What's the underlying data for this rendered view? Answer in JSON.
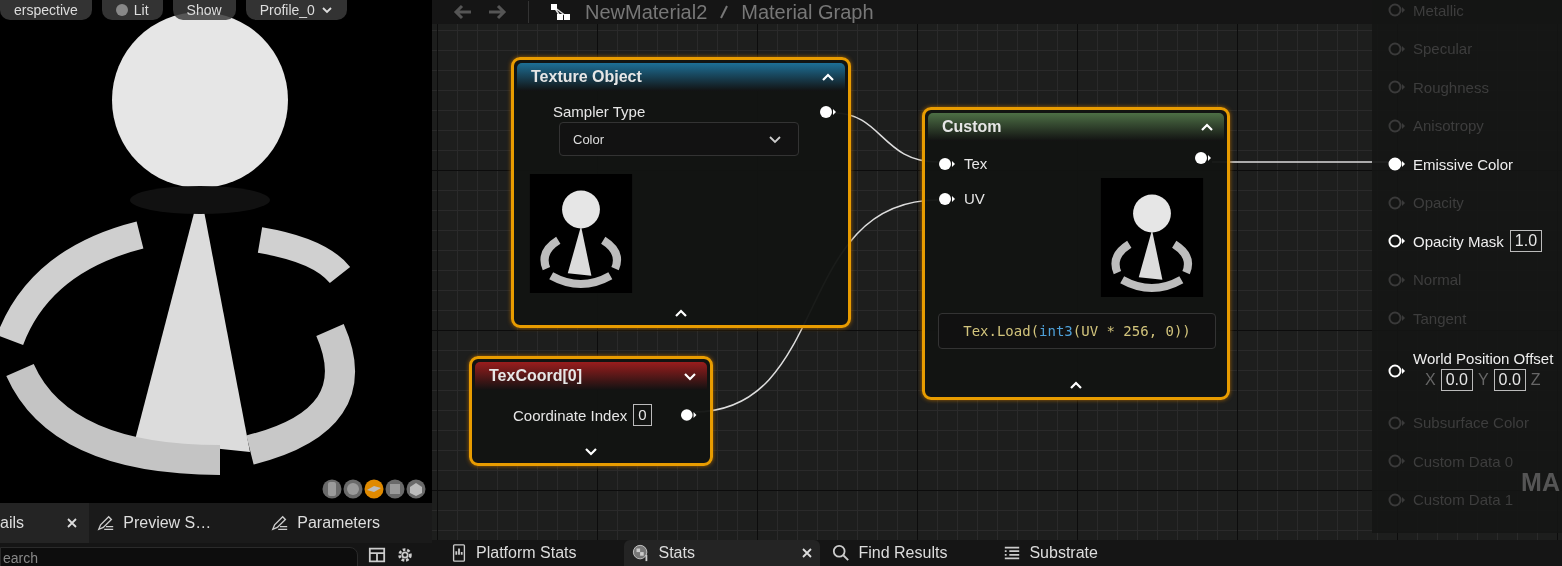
{
  "viewport": {
    "toolbar": [
      {
        "label": "erspective",
        "kind": "text"
      },
      {
        "label": "Lit",
        "kind": "lit"
      },
      {
        "label": "Show",
        "kind": "text"
      },
      {
        "label": "Profile_0",
        "kind": "dropdown"
      }
    ],
    "preview_shapes": [
      {
        "kind": "cylinder",
        "selected": false
      },
      {
        "kind": "sphere",
        "selected": false
      },
      {
        "kind": "plane",
        "selected": true
      },
      {
        "kind": "cube",
        "selected": false
      },
      {
        "kind": "mesh",
        "selected": false
      }
    ]
  },
  "details_panel": {
    "tabs": [
      {
        "label": "ails",
        "kind": "details",
        "selected": true,
        "closable": true
      },
      {
        "label": "Preview S…",
        "kind": "edit",
        "selected": false,
        "closable": false
      },
      {
        "label": "Parameters",
        "kind": "edit",
        "selected": false,
        "closable": false
      }
    ],
    "search": {
      "placeholder": "earch"
    }
  },
  "graph": {
    "breadcrumb": [
      "NewMaterial2",
      "Material Graph"
    ],
    "nodes": [
      {
        "kind": "texture_object",
        "title": "Texture Object",
        "color": "#1d6f96",
        "selected": true,
        "expanded": true,
        "property": "Sampler Type",
        "dropdown": "Color"
      },
      {
        "kind": "custom",
        "title": "Custom",
        "color": "#4d6f45",
        "selected": true,
        "expanded": true,
        "inputs": [
          "Tex",
          "UV"
        ],
        "code": [
          {
            "text": "Tex.Load(",
            "kind": "plain"
          },
          {
            "text": "int3",
            "kind": "keyword"
          },
          {
            "text": "(UV * 256, 0))",
            "kind": "plain"
          }
        ]
      },
      {
        "kind": "texcoord",
        "title": "TexCoord[0]",
        "color": "#9a1d1d",
        "selected": true,
        "expanded": false,
        "property": "Coordinate Index",
        "value": "0"
      }
    ],
    "output_pins": [
      {
        "label": "Metallic",
        "enabled": false,
        "connected": false
      },
      {
        "label": "Specular",
        "enabled": false,
        "connected": false
      },
      {
        "label": "Roughness",
        "enabled": false,
        "connected": false
      },
      {
        "label": "Anisotropy",
        "enabled": false,
        "connected": false
      },
      {
        "label": "Emissive Color",
        "enabled": true,
        "connected": true
      },
      {
        "label": "Opacity",
        "enabled": false,
        "connected": false
      },
      {
        "label": "Opacity Mask",
        "enabled": true,
        "connected": false,
        "fields": [
          {
            "value": "1.0"
          }
        ]
      },
      {
        "label": "Normal",
        "enabled": false,
        "connected": false
      },
      {
        "label": "Tangent",
        "enabled": false,
        "connected": false
      },
      {
        "label": "World Position Offset",
        "enabled": true,
        "connected": false,
        "fields": [
          {
            "axis": "X",
            "value": "0.0"
          },
          {
            "axis": "Y",
            "value": "0.0"
          },
          {
            "axis": "Z"
          }
        ]
      },
      {
        "label": "Subsurface Color",
        "enabled": false,
        "connected": false
      },
      {
        "label": "Custom Data 0",
        "enabled": false,
        "connected": false
      },
      {
        "label": "Custom Data 1",
        "enabled": false,
        "connected": false
      }
    ],
    "watermark": "MA"
  },
  "bottom_tabs": [
    {
      "label": "Platform Stats",
      "kind": "platform",
      "selected": false,
      "closable": false
    },
    {
      "label": "Stats",
      "kind": "stats",
      "selected": true,
      "closable": true
    },
    {
      "label": "Find Results",
      "kind": "search",
      "selected": false,
      "closable": false
    },
    {
      "label": "Substrate",
      "kind": "list",
      "selected": false,
      "closable": false
    }
  ]
}
